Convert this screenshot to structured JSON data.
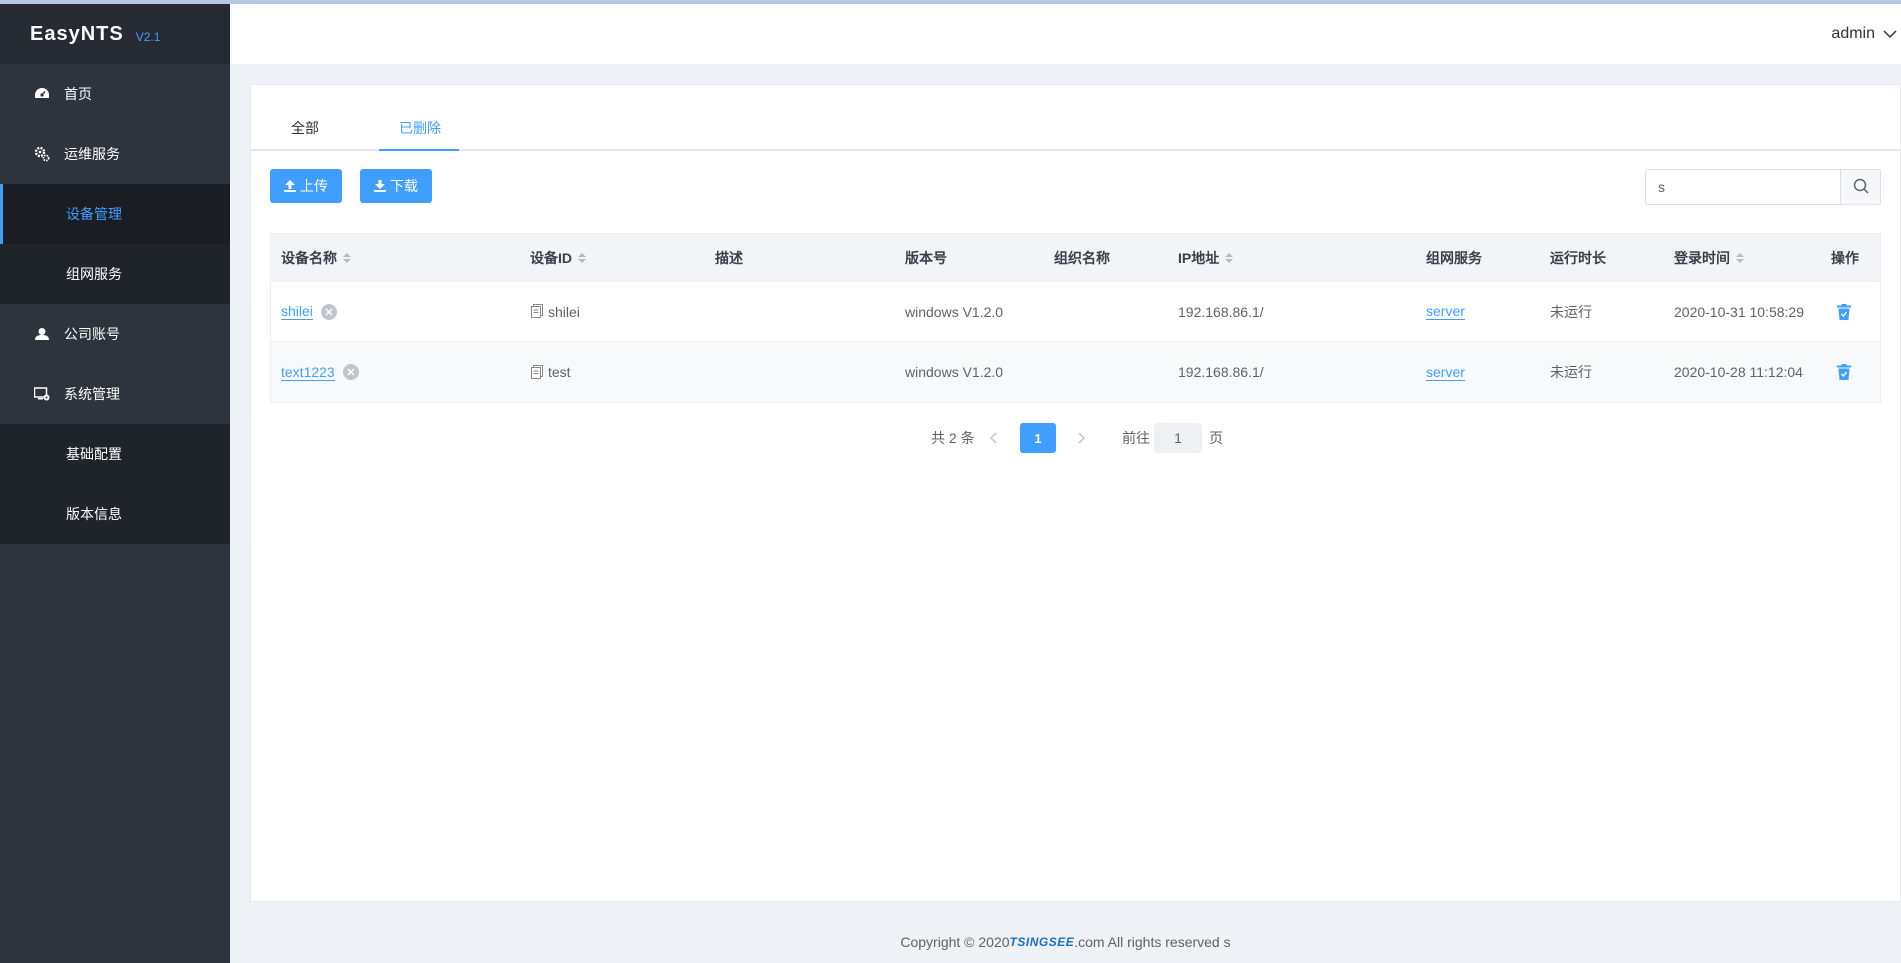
{
  "brand": {
    "name": "EasyNTS",
    "version": "V2.1"
  },
  "sidebar": {
    "items": [
      {
        "label": "首页",
        "icon": "dashboard-icon"
      },
      {
        "label": "运维服务",
        "icon": "gear-icon"
      },
      {
        "label": "设备管理"
      },
      {
        "label": "组网服务"
      },
      {
        "label": "公司账号",
        "icon": "user-group-icon"
      },
      {
        "label": "系统管理",
        "icon": "monitor-gear-icon"
      },
      {
        "label": "基础配置"
      },
      {
        "label": "版本信息"
      }
    ]
  },
  "header": {
    "user": "admin"
  },
  "tabs": [
    {
      "label": "全部"
    },
    {
      "label": "已删除"
    }
  ],
  "toolbar": {
    "upload_label": "上传",
    "download_label": "下载"
  },
  "search": {
    "value": "s"
  },
  "table": {
    "columns": [
      "设备名称",
      "设备ID",
      "描述",
      "版本号",
      "组织名称",
      "IP地址",
      "组网服务",
      "运行时长",
      "登录时间",
      "操作"
    ],
    "rows": [
      {
        "name": "shilei",
        "id": "shilei",
        "desc": "",
        "version": "windows V1.2.0",
        "org": "",
        "ip": "192.168.86.1/",
        "net": "server",
        "runtime": "未运行",
        "login": "2020-10-31 10:58:29"
      },
      {
        "name": "text1223",
        "id": "test",
        "desc": "",
        "version": "windows V1.2.0",
        "org": "",
        "ip": "192.168.86.1/",
        "net": "server",
        "runtime": "未运行",
        "login": "2020-10-28 11:12:04"
      }
    ]
  },
  "pagination": {
    "total": "共 2 条",
    "current": "1",
    "goto_label": "前往",
    "goto_value": "1",
    "unit": "页"
  },
  "footer": {
    "prefix": "Copyright © 2020 ",
    "brand": "TSINGSEE",
    "suffix": ".com All rights reserved s"
  },
  "colors": {
    "accent": "#409eff",
    "sidebar_bg": "#2e343d",
    "brand_bg": "#262b33",
    "submenu_bg": "#1f242b"
  }
}
